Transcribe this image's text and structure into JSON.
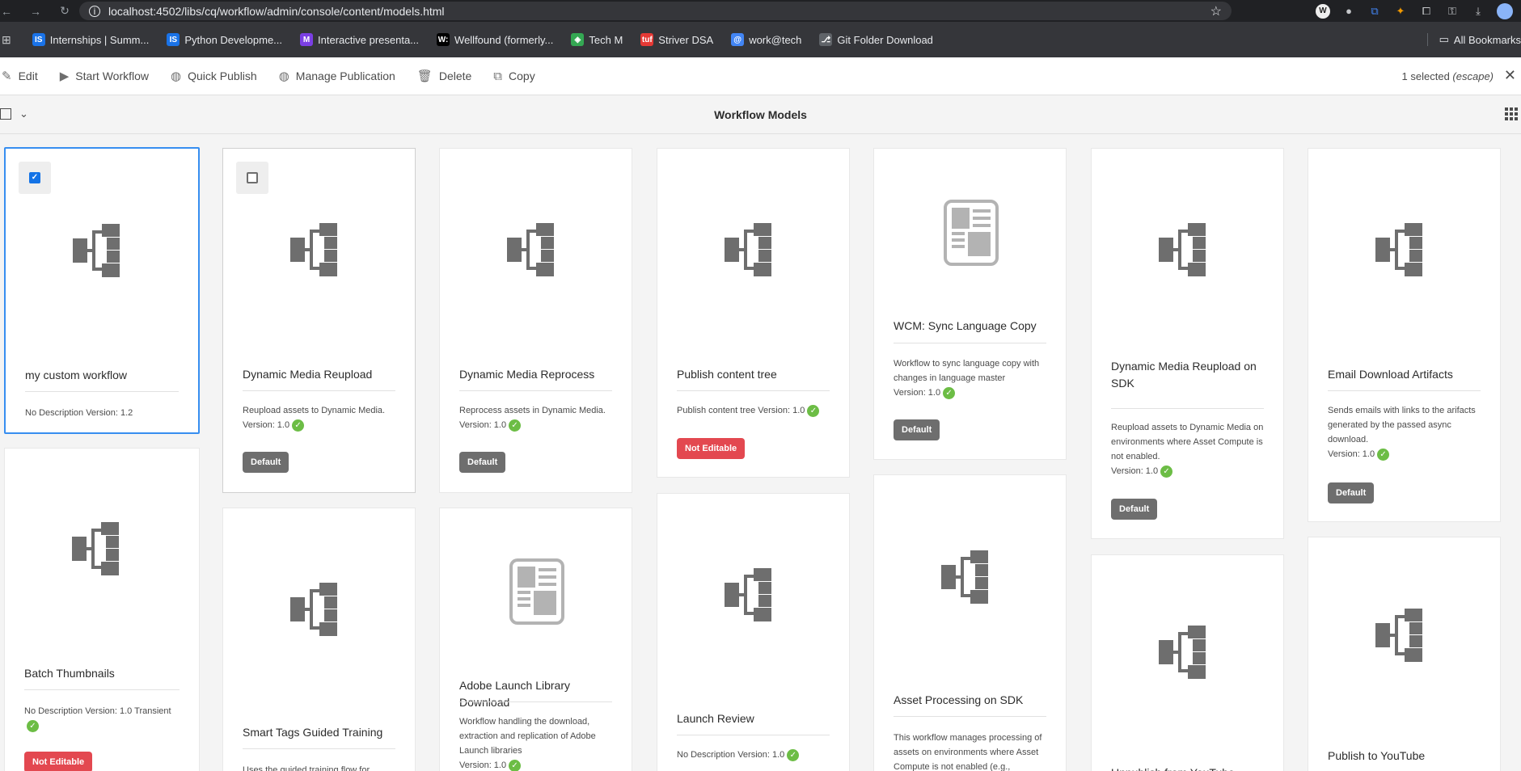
{
  "browser": {
    "url": "localhost:4502/libs/cq/workflow/admin/console/content/models.html",
    "bookmarks": [
      {
        "label": "Internships | Summ...",
        "icon": "IS",
        "color": "#1a73e8"
      },
      {
        "label": "Python Developme...",
        "icon": "IS",
        "color": "#1a73e8"
      },
      {
        "label": "Interactive presenta...",
        "icon": "M",
        "color": "#7b3fe4"
      },
      {
        "label": "Wellfound (formerly...",
        "icon": "W:",
        "color": "#000000"
      },
      {
        "label": "Tech M",
        "icon": "◈",
        "color": "#34a853"
      },
      {
        "label": "Striver DSA",
        "icon": "tuf",
        "color": "#e53935"
      },
      {
        "label": "work@tech",
        "icon": "@",
        "color": "#4285f4"
      },
      {
        "label": "Git Folder Download",
        "icon": "⎇",
        "color": "#5f6368"
      }
    ],
    "all_bookmarks": "All Bookmarks"
  },
  "toolbar": {
    "edit": "Edit",
    "start_workflow": "Start Workflow",
    "quick_publish": "Quick Publish",
    "manage_publication": "Manage Publication",
    "delete": "Delete",
    "copy": "Copy",
    "selected_count": "1 selected",
    "escape_hint": "(escape)"
  },
  "page": {
    "title": "Workflow Models"
  },
  "cards": [
    {
      "title": "my custom workflow",
      "desc": "No Description  Version: 1.2",
      "check": false,
      "badge": "",
      "thumb": "workflow-icon",
      "selected": true
    },
    {
      "title": "Dynamic Media Reupload",
      "desc": "Reupload assets to Dynamic Media.",
      "version": "Version: 1.0",
      "check": true,
      "badge": "Default",
      "thumb": "workflow-icon"
    },
    {
      "title": "Dynamic Media Reprocess",
      "desc": "Reprocess assets in Dynamic Media.",
      "version": "Version: 1.0",
      "check": true,
      "badge": "Default",
      "thumb": "workflow-icon"
    },
    {
      "title": "Publish content tree",
      "desc": "Publish content tree  Version: 1.0",
      "check": true,
      "badge": "Not Editable",
      "thumb": "workflow-icon"
    },
    {
      "title": "WCM: Sync Language Copy",
      "desc": "Workflow to sync language copy with changes in language master",
      "version": "Version: 1.0",
      "check": true,
      "badge": "Default",
      "thumb": "document-icon"
    },
    {
      "title": "Dynamic Media Reupload on SDK",
      "desc": "Reupload assets to Dynamic Media on environments where Asset Compute is not enabled.",
      "version": "Version: 1.0",
      "check": true,
      "badge": "Default",
      "thumb": "workflow-icon"
    },
    {
      "title": "Email Download Artifacts",
      "desc": "Sends emails with links to the arifacts generated by the passed async download.",
      "version": "Version: 1.0",
      "check": true,
      "badge": "Default",
      "thumb": "workflow-icon"
    },
    {
      "title": "Batch Thumbnails",
      "desc": "No Description  Version: 1.0  Transient",
      "check": true,
      "badge": "Not Editable",
      "thumb": "workflow-icon"
    },
    {
      "title": "Smart Tags Guided Training",
      "desc": "Uses the guided training flow for",
      "thumb": "workflow-icon"
    },
    {
      "title": "Adobe Launch Library Download",
      "desc": "Workflow handling the download, extraction and replication of Adobe Launch libraries",
      "version": "Version: 1.0",
      "check": true,
      "thumb": "document-icon"
    },
    {
      "title": "Launch Review",
      "desc": "No Description  Version: 1.0",
      "check": true,
      "thumb": "workflow-icon"
    },
    {
      "title": "Asset Processing on SDK",
      "desc": "This workflow manages processing of assets on environments where Asset Compute is not enabled (e.g.,",
      "thumb": "workflow-icon"
    },
    {
      "title": "Unpublish from YouTube",
      "thumb": "workflow-icon"
    },
    {
      "title": "Publish to YouTube",
      "thumb": "workflow-icon"
    }
  ],
  "colors": {
    "accent": "#1473e6",
    "success": "#6cbd45",
    "danger": "#e34850",
    "neutral_badge": "#6e6e6e"
  }
}
